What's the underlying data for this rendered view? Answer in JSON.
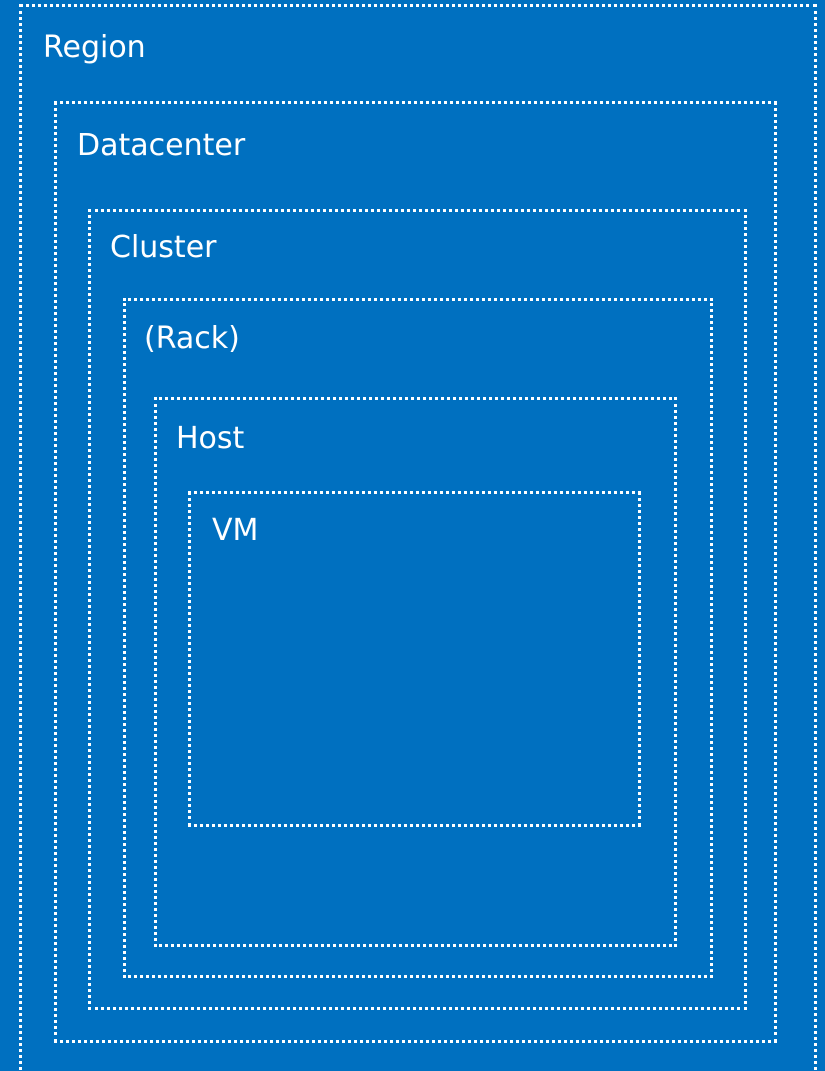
{
  "colors": {
    "background": "#0070c0",
    "line": "#ffffff",
    "text": "#ffffff"
  },
  "levels": [
    {
      "id": "region",
      "label": "Region"
    },
    {
      "id": "datacenter",
      "label": "Datacenter"
    },
    {
      "id": "cluster",
      "label": "Cluster"
    },
    {
      "id": "rack",
      "label": "(Rack)"
    },
    {
      "id": "host",
      "label": "Host"
    },
    {
      "id": "vm",
      "label": "VM"
    }
  ]
}
